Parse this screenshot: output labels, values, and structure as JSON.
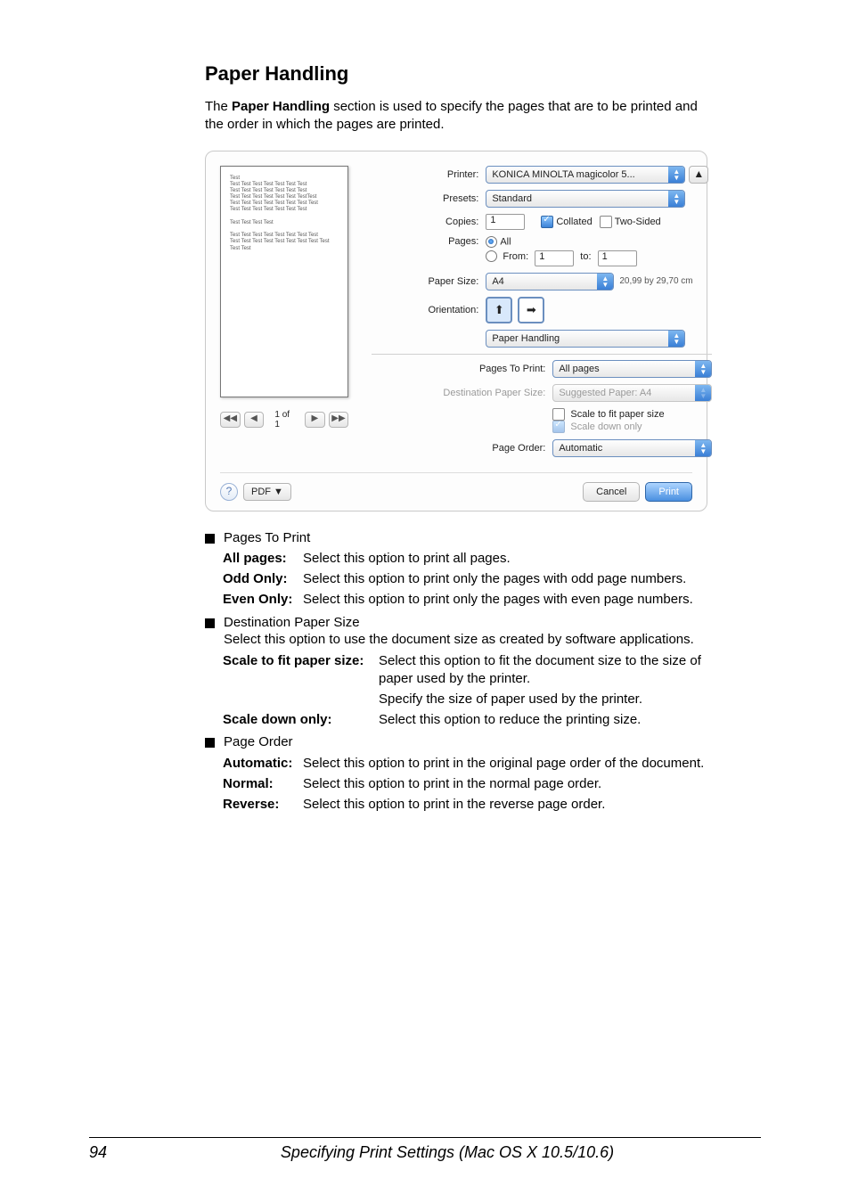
{
  "heading": "Paper Handling",
  "intro": "The Paper Handling section is used to specify the pages that are to be printed and the order in which the pages are printed.",
  "intro_bold": "Paper Handling",
  "dialog": {
    "preview_nav": {
      "first": "◀◀",
      "prev": "◀",
      "label": "1 of 1",
      "next": "▶",
      "last": "▶▶"
    },
    "printer_lbl": "Printer:",
    "printer_val": "KONICA MINOLTA magicolor 5...",
    "status": "▲",
    "presets_lbl": "Presets:",
    "presets_val": "Standard",
    "copies_lbl": "Copies:",
    "copies_val": "1",
    "collated": "Collated",
    "twosided": "Two-Sided",
    "pages_lbl": "Pages:",
    "all": "All",
    "from": "From:",
    "from_val": "1",
    "to": "to:",
    "to_val": "1",
    "size_lbl": "Paper Size:",
    "size_val": "A4",
    "size_note": "20,99 by 29,70 cm",
    "orient_lbl": "Orientation:",
    "section_val": "Paper Handling",
    "ptp_lbl": "Pages To Print:",
    "ptp_val": "All pages",
    "dps_lbl": "Destination Paper Size:",
    "dps_val": "Suggested Paper: A4",
    "scalefit": "Scale to fit paper size",
    "scaledown": "Scale down only",
    "po_lbl": "Page Order:",
    "po_val": "Automatic",
    "help": "?",
    "pdf": "PDF ▼",
    "cancel": "Cancel",
    "print": "Print"
  },
  "bullets": {
    "ptp": "Pages To Print",
    "ptp_all_t": "All pages:",
    "ptp_all_d": "Select this option to print all pages.",
    "ptp_odd_t": "Odd Only:",
    "ptp_odd_d": "Select this option to print only the pages with odd page numbers.",
    "ptp_even_t": "Even Only:",
    "ptp_even_d": "Select this option to print only the pages with even page numbers.",
    "dps": "Destination Paper Size",
    "dps_text": "Select this option to use the document size as created by software applications.",
    "dps_sf_t": "Scale to fit paper size:",
    "dps_sf_d": "Select this option to fit the document size to the size of paper used by the printer.",
    "dps_sp_d": "Specify the size of paper used by the printer.",
    "dps_sd_t": "Scale down only:",
    "dps_sd_d": "Select this option to reduce the printing size.",
    "po": "Page Order",
    "po_auto_t": "Automatic:",
    "po_auto_d": "Select this option to print in the original page order of the document.",
    "po_norm_t": "Normal:",
    "po_norm_d": "Select this option to print in the normal page order.",
    "po_rev_t": "Reverse:",
    "po_rev_d": "Select this option to print in the reverse page order."
  },
  "footer": {
    "page": "94",
    "title": "Specifying Print Settings (Mac OS X 10.5/10.6)"
  }
}
